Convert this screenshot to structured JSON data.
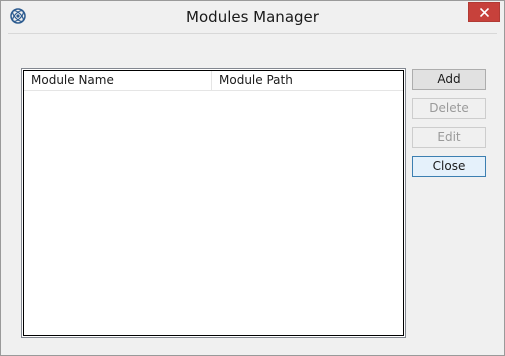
{
  "window": {
    "title": "Modules Manager",
    "app_icon": "ea-orbit-icon",
    "close_icon": "close-icon"
  },
  "table": {
    "columns": [
      "Module Name",
      "Module Path"
    ],
    "rows": []
  },
  "buttons": {
    "add": "Add",
    "delete": "Delete",
    "edit": "Edit",
    "close": "Close"
  },
  "colors": {
    "close_button": "#c7413b",
    "default_button_border": "#3c7fb1"
  }
}
